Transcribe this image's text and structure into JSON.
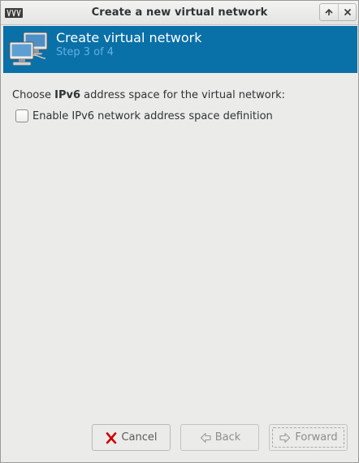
{
  "window": {
    "title": "Create a new virtual network",
    "icons": [
      "virt-manager-logo-icon",
      "maximize-icon",
      "close-icon"
    ]
  },
  "banner": {
    "title": "Create virtual network",
    "step": "Step 3 of 4",
    "icon": "network-computers-icon",
    "background_color": "#0a70a8",
    "step_color": "#63b0e2"
  },
  "content": {
    "prompt_before": "Choose ",
    "prompt_bold": "IPv6",
    "prompt_after": " address space for the virtual network:",
    "enable_ipv6": {
      "label": "Enable IPv6 network address space definition",
      "checked": false
    }
  },
  "buttons": {
    "cancel": {
      "label": "Cancel",
      "icon": "cancel-x-icon"
    },
    "back": {
      "label": "Back",
      "icon": "back-arrow-icon",
      "enabled": false
    },
    "forward": {
      "label": "Forward",
      "icon": "forward-arrow-icon",
      "enabled": false
    }
  }
}
